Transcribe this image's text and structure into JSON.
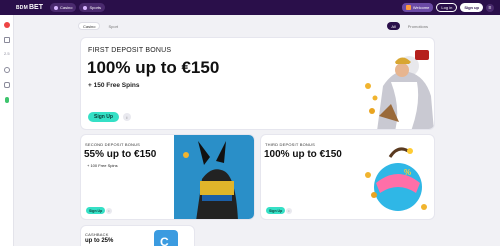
{
  "header": {
    "logo_mark": "BDM",
    "logo_text": "BET",
    "nav": [
      {
        "label": "Casino",
        "icon": "casino-icon"
      },
      {
        "label": "Sports",
        "icon": "sports-icon"
      }
    ],
    "promo_label": "Welcome",
    "login_label": "Log in",
    "signup_label": "Sign up"
  },
  "tabs": [
    {
      "label": "Casino",
      "active": true
    },
    {
      "label": "Sport",
      "active": false
    }
  ],
  "filters": [
    {
      "label": "All",
      "active": true
    },
    {
      "label": "Promotions",
      "active": false
    }
  ],
  "cards": {
    "hero": {
      "kicker": "FIRST DEPOSIT BONUS",
      "headline": "100% up to €150",
      "sub": "+ 150 Free Spins",
      "cta": "Sign Up",
      "info": "i"
    },
    "second": {
      "kicker": "SECOND DEPOSIT BONUS",
      "headline": "55% up to €150",
      "sub": "+ 100 Free Spins",
      "cta": "Sign Up",
      "info": "i"
    },
    "third": {
      "kicker": "THIRD DEPOSIT BONUS",
      "headline": "100% up to €150",
      "cta": "Sign Up",
      "info": "i"
    },
    "fourth": {
      "kicker": "CASHBACK",
      "headline": "up to 25%"
    }
  },
  "colors": {
    "brand": "#2a0f4a",
    "accent": "#35e0c6"
  }
}
